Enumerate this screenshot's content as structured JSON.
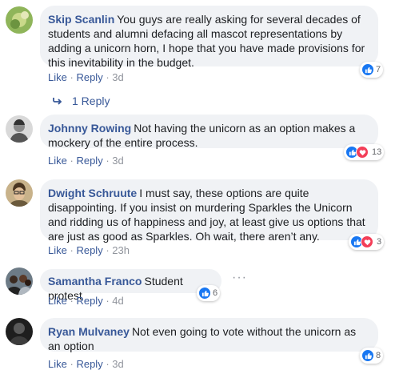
{
  "action_labels": {
    "like": "Like",
    "reply": "Reply",
    "sep": "·"
  },
  "comments": [
    {
      "author": "Skip Scanlin",
      "text": "You guys are really asking for several decades of students and alumni defacing all mascot representations by adding a unicorn horn, I hope that you have made provisions for this inevitability in the budget.",
      "time": "3d",
      "reactions": [
        "like"
      ],
      "count": "7"
    },
    {
      "author": "Johnny Rowing",
      "text": "Not having the unicorn as an option makes a mockery of the entire process.",
      "time": "3d",
      "reactions": [
        "like",
        "love"
      ],
      "count": "13"
    },
    {
      "author": "Dwight Schruute",
      "text": "I must say, these options are quite disappointing. If you insist on murdering Sparkles the Unicorn and ridding us of happiness and joy, at least give us options that are just as good as Sparkles. Oh wait, there aren’t any.",
      "time": "23h",
      "reactions": [
        "like",
        "love"
      ],
      "count": "3"
    },
    {
      "author": "Samantha Franco",
      "text": "Student protest",
      "time": "4d",
      "reactions": [
        "like"
      ],
      "count": "6"
    },
    {
      "author": "Ryan Mulvaney",
      "text": "Not even going to vote without the unicorn as an option",
      "time": "3d",
      "reactions": [
        "like"
      ],
      "count": "8"
    }
  ],
  "replies_link": {
    "label": "1 Reply",
    "icon": "reply-arrow-icon"
  },
  "more_icon": "more-options-icon",
  "colors": {
    "author": "#385898",
    "bubble": "#f0f2f5",
    "like": "#1877f2",
    "love": "#f33e58",
    "meta": "#90949c"
  }
}
